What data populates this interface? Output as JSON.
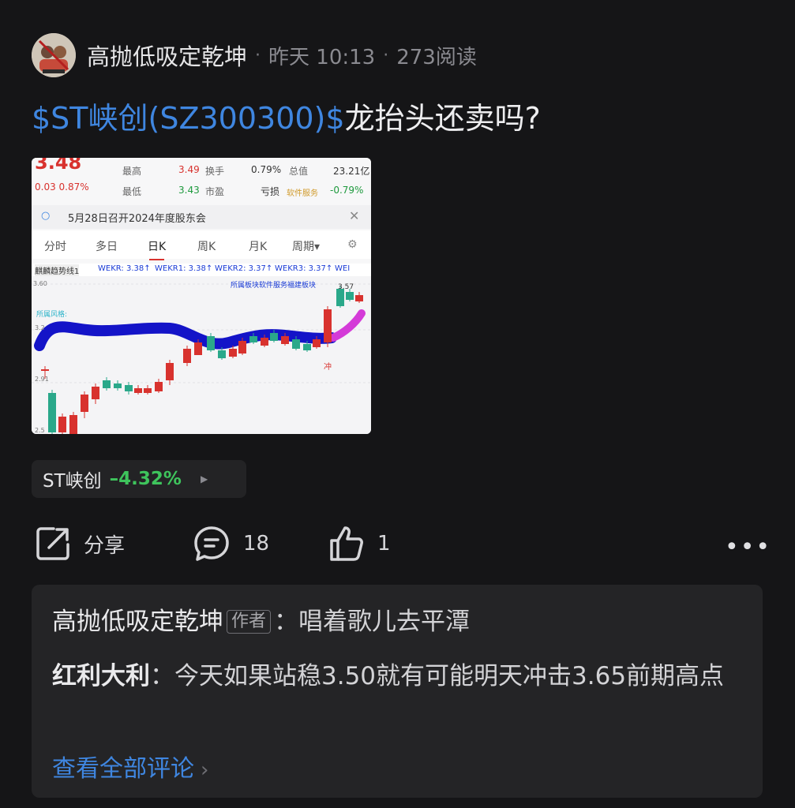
{
  "post": {
    "author": "高抛低吸定乾坤",
    "time": "昨天 10:13",
    "reads": "273阅读",
    "title_tag": "$ST峡创(SZ300300)$",
    "title_rest": "龙抬头还卖吗?"
  },
  "screenshot": {
    "price": "3.48",
    "change": "0.03 0.87%",
    "high_label": "最高",
    "high_value": "3.49",
    "low_label": "最低",
    "low_value": "3.43",
    "turnover_label": "换手",
    "turnover_value": "0.79%",
    "pe_label": "市盈",
    "mktcap_label": "总值",
    "mktcap_value": "23.21亿",
    "loss_label": "亏损",
    "sector_label": "软件服务",
    "sector_change": "-0.79%",
    "notice": "5月28日召开2024年度股东会",
    "tabs": [
      "分时",
      "多日",
      "日K",
      "周K",
      "月K",
      "周期▾"
    ],
    "indicator": "麒麟趋势线1",
    "wek_labels": [
      "WEKR: 3.38↑",
      "WEKR1: 3.38↑",
      "WEKR2: 3.37↑",
      "WEKR3: 3.37↑",
      "WEI"
    ],
    "chart_labels": {
      "top_price": "3.60",
      "sector_text": "所属板块软件服务福建板块",
      "peak": "3.57",
      "style": "所属风格:",
      "mid": "3.2",
      "low1": "2.91",
      "low2": "2.5",
      "chong": "冲"
    }
  },
  "stock_pill": {
    "name": "ST峡创",
    "change": "–4.32%"
  },
  "actions": {
    "share": "分享",
    "comments": "18",
    "likes": "1"
  },
  "comments": {
    "first_author": "高抛低吸定乾坤",
    "author_badge": "作者",
    "first_text": "唱着歌儿去平潭",
    "second_author": "红利大利",
    "second_text": "今天如果站稳3.50就有可能明天冲击3.65前期高点",
    "view_all": "查看全部评论"
  },
  "icons": [
    "avatar",
    "share-icon",
    "comment-icon",
    "like-icon",
    "more-icon",
    "chevron-right-icon"
  ],
  "colors": {
    "link_blue": "#3f86e0",
    "up_red": "#d8322e",
    "down_green": "#3ec45c"
  }
}
